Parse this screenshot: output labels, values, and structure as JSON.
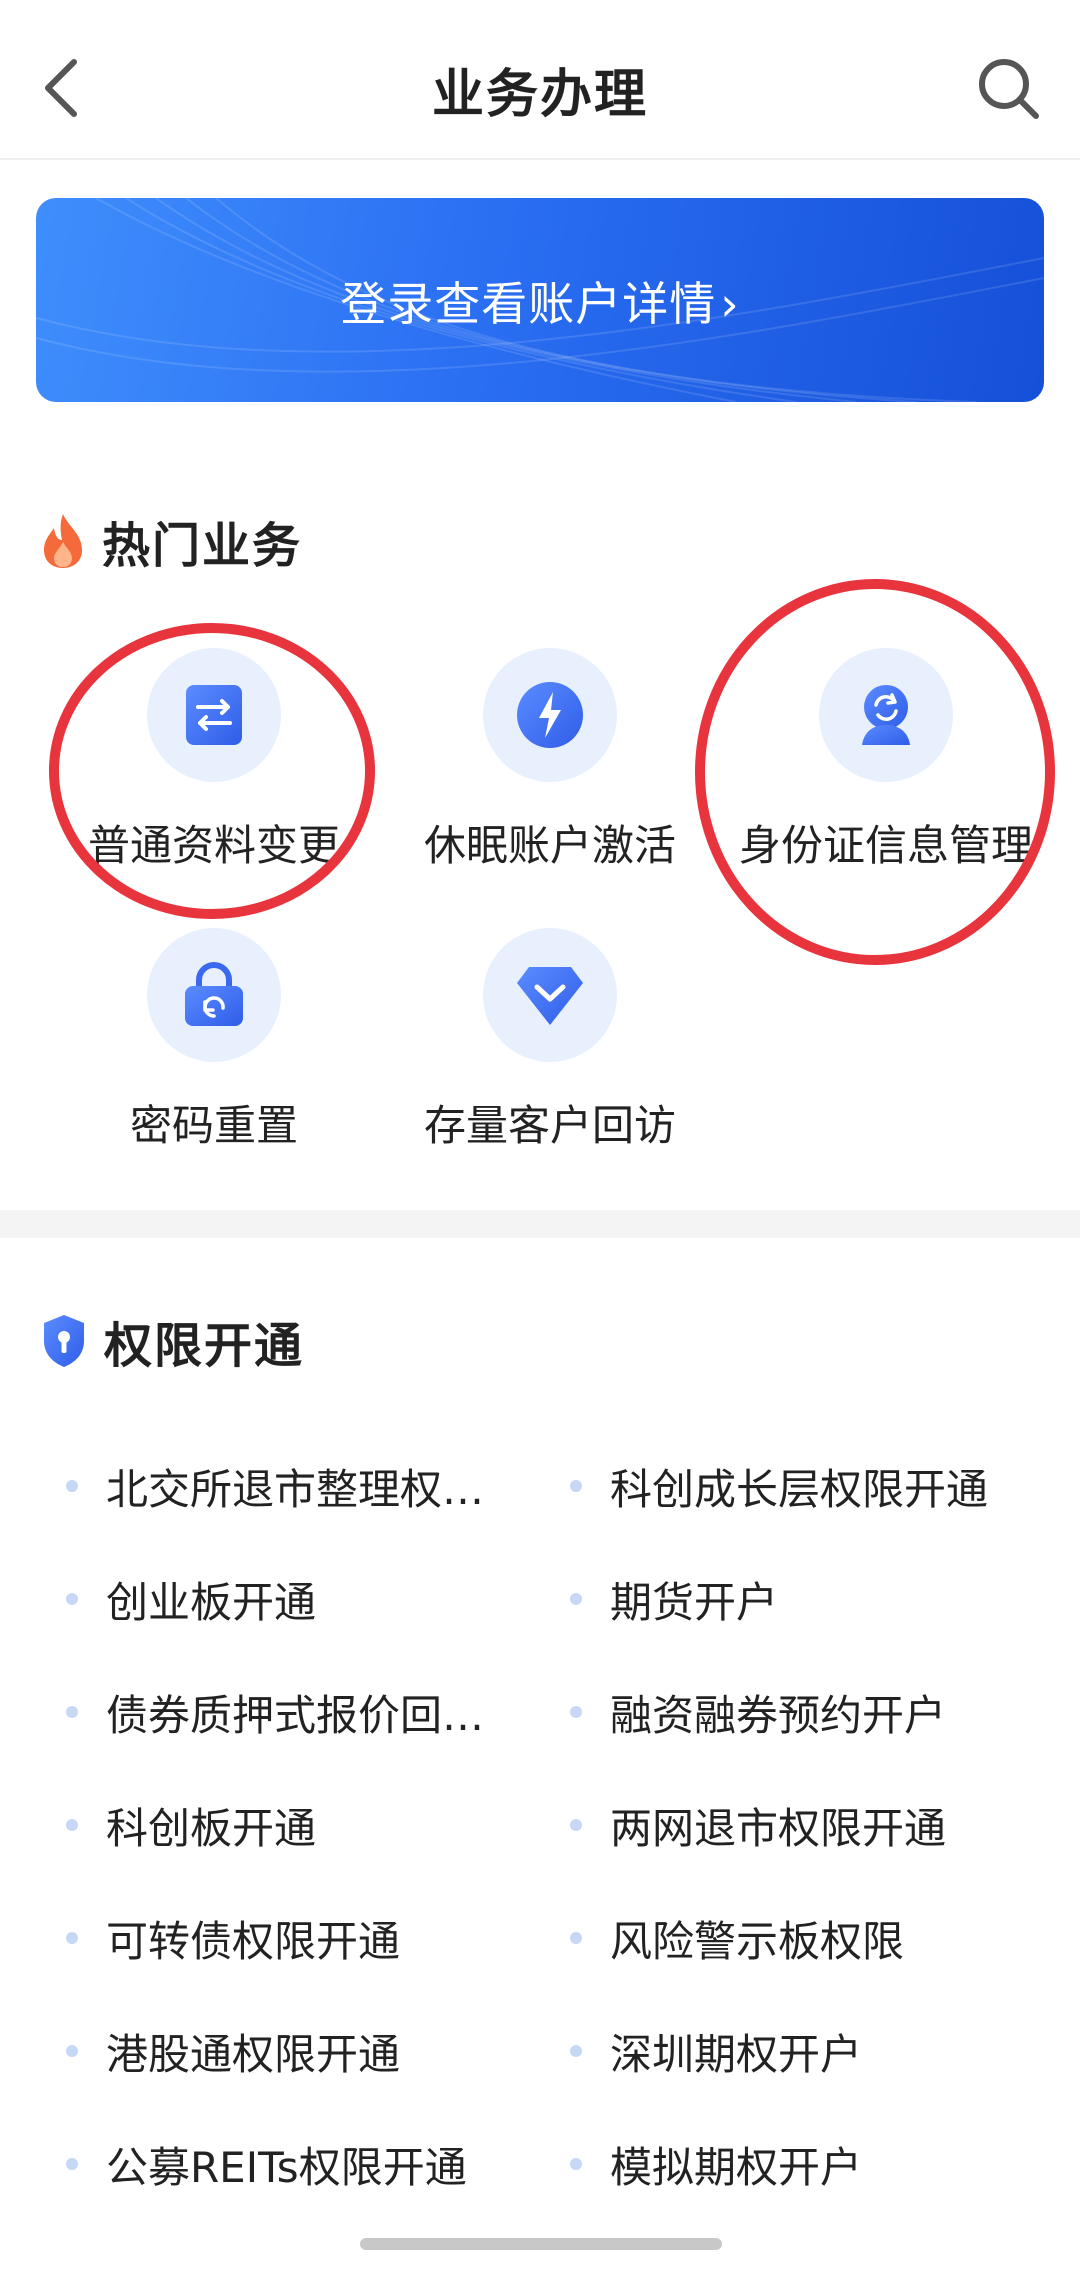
{
  "header": {
    "title": "业务办理",
    "back_icon": "chevron-left-icon",
    "search_icon": "search-icon"
  },
  "banner": {
    "text": "登录查看账户详情",
    "chevron": "›",
    "colors": {
      "start": "#3f8efc",
      "end": "#1550d8"
    }
  },
  "hot_services": {
    "title": "热门业务",
    "icon": "flame-icon",
    "items": [
      {
        "label": "普通资料变更",
        "icon": "swap-arrows-icon"
      },
      {
        "label": "休眠账户激活",
        "icon": "lightning-icon"
      },
      {
        "label": "身份证信息管理",
        "icon": "id-person-refresh-icon"
      },
      {
        "label": "密码重置",
        "icon": "lock-reset-icon"
      },
      {
        "label": "存量客户回访",
        "icon": "diamond-check-icon"
      }
    ]
  },
  "permissions": {
    "title": "权限开通",
    "icon": "shield-lock-icon",
    "left": [
      "北交所退市整理权限开通",
      "创业板开通",
      "债券质押式报价回购开通",
      "科创板开通",
      "可转债权限开通",
      "港股通权限开通",
      "公募REITs权限开通"
    ],
    "right": [
      "科创成长层权限开通",
      "期货开户",
      "融资融券预约开户",
      "两网退市权限开通",
      "风险警示板权限",
      "深圳期权开户",
      "模拟期权开户"
    ]
  },
  "colors": {
    "accent": "#2a6ef2",
    "icon_bg": "#e8effd",
    "annotation": "#e8343c"
  }
}
